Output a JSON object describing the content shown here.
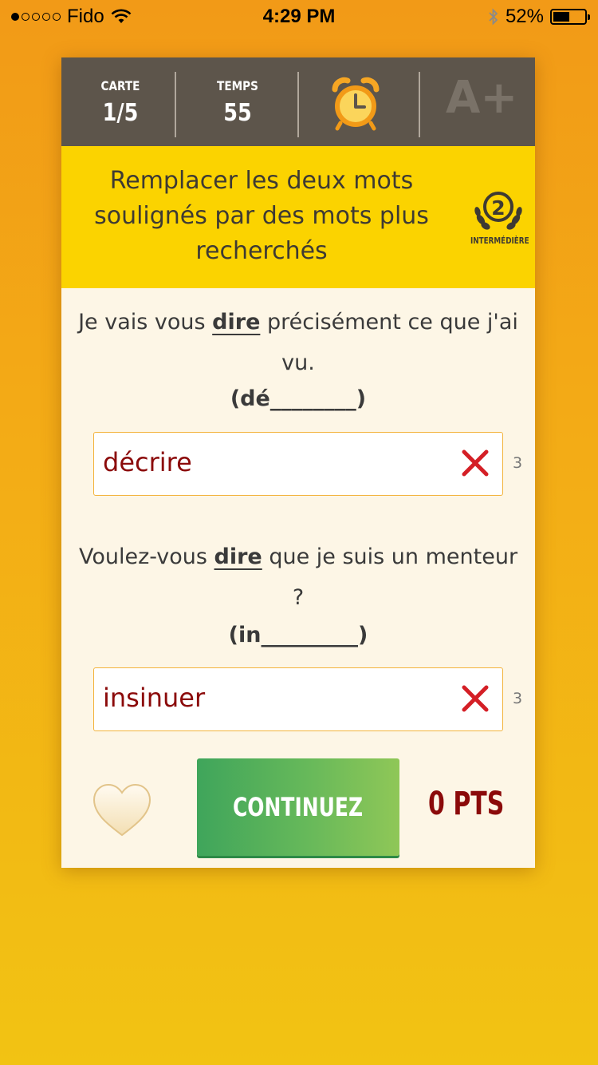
{
  "status_bar": {
    "carrier": "Fido",
    "time": "4:29 PM",
    "battery_percent": "52%",
    "battery_level": 0.52,
    "signal_dots": [
      true,
      false,
      false,
      false,
      false
    ],
    "icons": [
      "wifi-icon",
      "bluetooth-icon",
      "battery-icon"
    ]
  },
  "header": {
    "card_label": "CARTE",
    "card_value": "1/5",
    "time_label": "TEMPS",
    "time_value": "55",
    "alarm_icon": "alarm-clock-icon",
    "grade_text": "A+"
  },
  "banner": {
    "instruction": "Remplacer les deux mots soulignés par des mots plus recherchés",
    "level_number": "2",
    "level_label": "INTERMÉDIÈRE"
  },
  "questions": [
    {
      "before": "Je vais vous ",
      "underlined": "dire",
      "after": " précisément ce que j'ai vu.",
      "hint": "(dé________)",
      "answer": "décrire",
      "count": "3"
    },
    {
      "before": "Voulez-vous ",
      "underlined": "dire",
      "after": " que je suis un menteur ?",
      "hint": "(in_________)",
      "answer": "insinuer",
      "count": "3"
    }
  ],
  "footer": {
    "continue_label": "CONTINUEZ",
    "points": "0 PTS"
  },
  "colors": {
    "background_top": "#f29a17",
    "background_bottom": "#f2c313",
    "header": "#5d554b",
    "banner": "#fbd300",
    "card": "#fdf6e6",
    "answer_text": "#8b0a0a",
    "wrong_mark": "#d41f26",
    "continue_button": "#4caf50"
  }
}
